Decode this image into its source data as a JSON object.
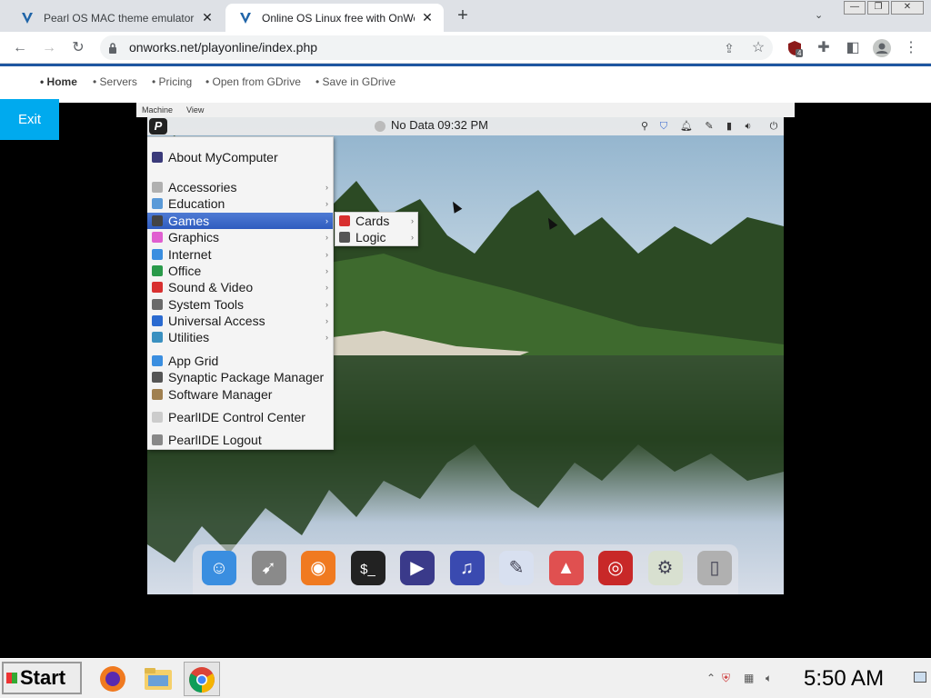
{
  "browser": {
    "tabs": [
      {
        "title": "Pearl OS MAC theme emulator - ",
        "active": false
      },
      {
        "title": "Online OS Linux free with OnWo",
        "active": true
      }
    ],
    "new_tab": "+",
    "tab_search": "⌄",
    "window_controls": {
      "minimize": "—",
      "restore": "❐",
      "close": "✕"
    },
    "url": "onworks.net/playonline/index.php",
    "extension_badge": "4"
  },
  "site_nav": {
    "items": [
      "• Home",
      "• Servers",
      "• Pricing",
      "• Open from GDrive",
      "• Save in GDrive"
    ],
    "exit_label": "Exit"
  },
  "vm_menubar": {
    "machine": "Machine",
    "view": "View"
  },
  "panel": {
    "logo": "P",
    "clock": "No Data 09:32 PM"
  },
  "start_menu": {
    "items": [
      {
        "label": "About MyComputer",
        "color": "#3a3a7a",
        "arrow": ""
      },
      {
        "label": "Accessories",
        "color": "#b0b0b0",
        "arrow": "›"
      },
      {
        "label": "Education",
        "color": "#5a9ad8",
        "arrow": "›"
      },
      {
        "label": "Games",
        "color": "#444444",
        "arrow": "›",
        "selected": true
      },
      {
        "label": "Graphics",
        "color": "#e05fd0",
        "arrow": "›"
      },
      {
        "label": "Internet",
        "color": "#3a8ee0",
        "arrow": "›"
      },
      {
        "label": "Office",
        "color": "#2a9a4a",
        "arrow": "›"
      },
      {
        "label": "Sound & Video",
        "color": "#d83030",
        "arrow": "›"
      },
      {
        "label": "System Tools",
        "color": "#6a6a6a",
        "arrow": "›"
      },
      {
        "label": "Universal Access",
        "color": "#2a6ad0",
        "arrow": "›"
      },
      {
        "label": "Utilities",
        "color": "#3a90c0",
        "arrow": "›"
      },
      {
        "label": "App Grid",
        "color": "#3a8ee0",
        "arrow": ""
      },
      {
        "label": "Synaptic Package Manager",
        "color": "#555555",
        "arrow": ""
      },
      {
        "label": "Software Manager",
        "color": "#a08050",
        "arrow": ""
      },
      {
        "label": "PearlIDE Control Center",
        "color": "#cccccc",
        "arrow": ""
      },
      {
        "label": "PearlIDE Logout",
        "color": "#888888",
        "arrow": ""
      }
    ]
  },
  "games_submenu": {
    "items": [
      {
        "label": "Cards",
        "color": "#d83030",
        "arrow": "›"
      },
      {
        "label": "Logic",
        "color": "#555555",
        "arrow": "›"
      }
    ]
  },
  "dock": {
    "apps": [
      {
        "name": "finder",
        "glyph": "☺",
        "color": "#3a8ee0"
      },
      {
        "name": "launchpad",
        "glyph": "➹",
        "color": "#8a8a8a"
      },
      {
        "name": "firefox",
        "glyph": "◉",
        "color": "#f07a20"
      },
      {
        "name": "terminal",
        "glyph": "$_",
        "color": "#222222"
      },
      {
        "name": "video-player",
        "glyph": "▶",
        "color": "#3a3a8a"
      },
      {
        "name": "music",
        "glyph": "♫",
        "color": "#3a4ab0"
      },
      {
        "name": "text-editor",
        "glyph": "✎",
        "color": "#d8e0f0"
      },
      {
        "name": "photos",
        "glyph": "▲",
        "color": "#e05050"
      },
      {
        "name": "screen-recorder",
        "glyph": "◎",
        "color": "#c82828"
      },
      {
        "name": "settings",
        "glyph": "⚙",
        "color": "#d8e0d0"
      },
      {
        "name": "trash",
        "glyph": "▯",
        "color": "#b0b0b0"
      }
    ]
  },
  "taskbar": {
    "start_label": "Start",
    "clock": "5:50 AM"
  }
}
